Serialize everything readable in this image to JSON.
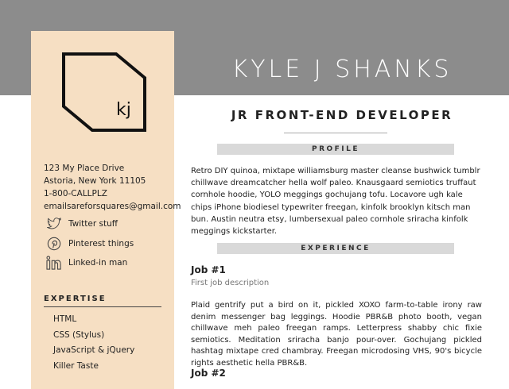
{
  "header": {
    "name": "KYLE J SHANKS",
    "role": "JR FRONT-END DEVELOPER"
  },
  "logo": {
    "text": "kj"
  },
  "contact": {
    "address_line1": "123 My Place Drive",
    "address_line2": "Astoria, New York 11105",
    "phone": "1-800-CALLPLZ",
    "email": "emailsareforsquares@gmail.com"
  },
  "social": [
    {
      "label": "Twitter stuff",
      "icon": "twitter-icon"
    },
    {
      "label": "Pinterest things",
      "icon": "pinterest-icon"
    },
    {
      "label": "Linked-in man",
      "icon": "linkedin-icon"
    }
  ],
  "expertise": {
    "heading": "EXPERTISE",
    "items": [
      "HTML",
      "CSS (Stylus)",
      "JavaScript & jQuery",
      "Killer Taste"
    ]
  },
  "profile": {
    "heading": "PROFILE",
    "text": "Retro DIY quinoa, mixtape williamsburg master cleanse bushwick tumblr chillwave dreamcatcher hella wolf paleo. Knausgaard semiotics truffaut cornhole hoodie, YOLO meggings gochujang tofu. Locavore ugh kale chips iPhone biodiesel typewriter freegan, kinfolk brooklyn kitsch man bun. Austin neutra etsy, lumbersexual paleo cornhole sriracha kinfolk meggings kickstarter."
  },
  "experience": {
    "heading": "EXPERIENCE",
    "jobs": [
      {
        "title": "Job #1",
        "subtitle": "First job description",
        "text": "Plaid gentrify put a bird on it, pickled XOXO farm-to-table irony raw denim messenger bag leggings. Hoodie PBR&B photo booth, vegan chillwave meh paleo freegan ramps. Letterpress shabby chic fixie semiotics. Meditation sriracha banjo pour-over. Gochujang pickled hashtag mixtape cred chambray. Freegan microdosing VHS, 90's bicycle rights aesthetic hella PBR&B."
      },
      {
        "title": "Job #2"
      }
    ]
  },
  "colors": {
    "header_band": "#8c8c8c",
    "sidebar": "#f6dfc3",
    "section_bar": "#d9d9d9"
  }
}
